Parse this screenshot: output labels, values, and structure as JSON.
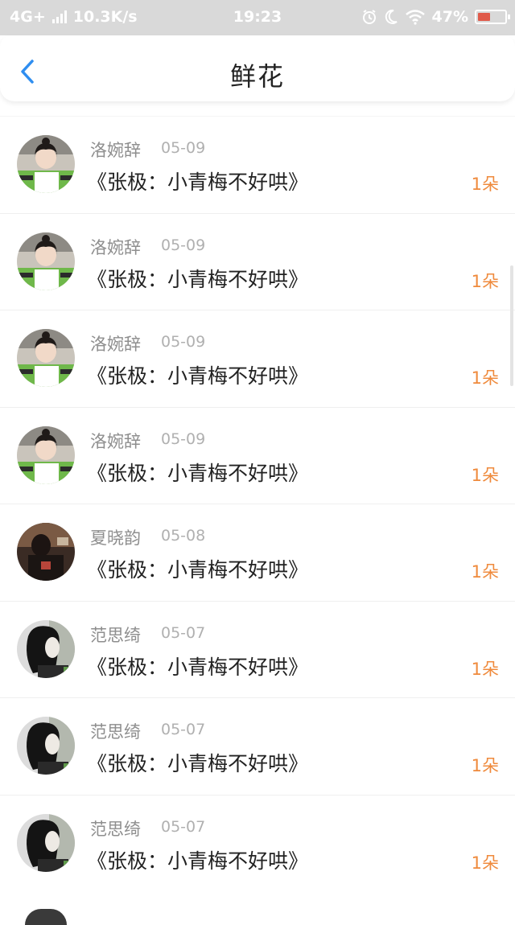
{
  "status_bar": {
    "network": "4G+",
    "speed": "10.3K/s",
    "time": "19:23",
    "battery": "47%",
    "battery_level": 0.47
  },
  "header": {
    "title": "鲜花"
  },
  "colors": {
    "accent": "#2f8ef0",
    "count": "#ef8a3c",
    "name": "#8e8e8e",
    "date": "#b0b0b0",
    "title": "#222222"
  },
  "items": [
    {
      "name": "洛婉辞",
      "date": "05-09",
      "title": "《张极：小青梅不好哄》",
      "count": "1朵",
      "avatar": "avatar-girl-green"
    },
    {
      "name": "洛婉辞",
      "date": "05-09",
      "title": "《张极：小青梅不好哄》",
      "count": "1朵",
      "avatar": "avatar-girl-green"
    },
    {
      "name": "洛婉辞",
      "date": "05-09",
      "title": "《张极：小青梅不好哄》",
      "count": "1朵",
      "avatar": "avatar-girl-green"
    },
    {
      "name": "洛婉辞",
      "date": "05-09",
      "title": "《张极：小青梅不好哄》",
      "count": "1朵",
      "avatar": "avatar-girl-green"
    },
    {
      "name": "夏晓韵",
      "date": "05-08",
      "title": "《张极：小青梅不好哄》",
      "count": "1朵",
      "avatar": "avatar-dark"
    },
    {
      "name": "范思绮",
      "date": "05-07",
      "title": "《张极：小青梅不好哄》",
      "count": "1朵",
      "avatar": "avatar-profile"
    },
    {
      "name": "范思绮",
      "date": "05-07",
      "title": "《张极：小青梅不好哄》",
      "count": "1朵",
      "avatar": "avatar-profile"
    },
    {
      "name": "范思绮",
      "date": "05-07",
      "title": "《张极：小青梅不好哄》",
      "count": "1朵",
      "avatar": "avatar-profile"
    }
  ]
}
